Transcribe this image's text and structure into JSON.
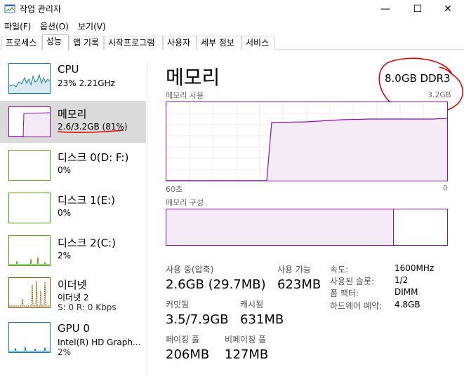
{
  "window": {
    "title": "작업 관리자",
    "min_glyph": "—",
    "max_glyph": "☐",
    "close_glyph": "✕"
  },
  "menu": [
    "파일(F)",
    "옵션(O)",
    "보기(V)"
  ],
  "tabs": [
    "프로세스",
    "성능",
    "앱 기록",
    "시작프로그램",
    "사용자",
    "세부 정보",
    "서비스"
  ],
  "active_tab": "성능",
  "sidebar": {
    "items": [
      {
        "title": "CPU",
        "sub": "23%  2.21GHz",
        "sub2": ""
      },
      {
        "title": "메모리",
        "sub": "2.6/3.2GB (81%)",
        "sub2": ""
      },
      {
        "title": "디스크 0(D: F:)",
        "sub": "0%",
        "sub2": ""
      },
      {
        "title": "디스크 1(E:)",
        "sub": "0%",
        "sub2": ""
      },
      {
        "title": "디스크 2(C:)",
        "sub": "2%",
        "sub2": ""
      },
      {
        "title": "이더넷",
        "sub": "이더넷 2",
        "sub2": "S: 0  R: 0 Kbps"
      },
      {
        "title": "GPU 0",
        "sub": "Intel(R) HD Graph...",
        "sub2": "2%"
      }
    ],
    "selected_index": 1
  },
  "main": {
    "title": "메모리",
    "spec": "8.0GB DDR3",
    "usage_label": "메모리 사용",
    "usage_max": "3.2GB",
    "time_left": "60초",
    "time_right": "0",
    "composition_label": "메모리 구성",
    "composition_in_use_fraction": 0.81,
    "stats": {
      "in_use_label": "사용 중(압축)",
      "in_use_value": "2.6GB (29.7MB)",
      "available_label": "사용 가능",
      "available_value": "623MB",
      "committed_label": "커밋됨",
      "committed_value": "3.5/7.9GB",
      "cached_label": "캐시됨",
      "cached_value": "631MB",
      "paged_label": "페이징 풀",
      "paged_value": "206MB",
      "nonpaged_label": "비페이징 풀",
      "nonpaged_value": "127MB"
    },
    "specs": [
      {
        "label": "속도:",
        "value": "1600MHz"
      },
      {
        "label": "사용된 슬롯:",
        "value": "1/2"
      },
      {
        "label": "폼 팩터:",
        "value": "DIMM"
      },
      {
        "label": "하드웨어 예약:",
        "value": "4.8GB"
      }
    ]
  },
  "colors": {
    "memory": "#8b12ae",
    "cpu": "#117dbb",
    "disk": "#4da60c",
    "ethernet": "#a74f01",
    "gpu": "#117dbb",
    "annotation": "#e00000"
  }
}
